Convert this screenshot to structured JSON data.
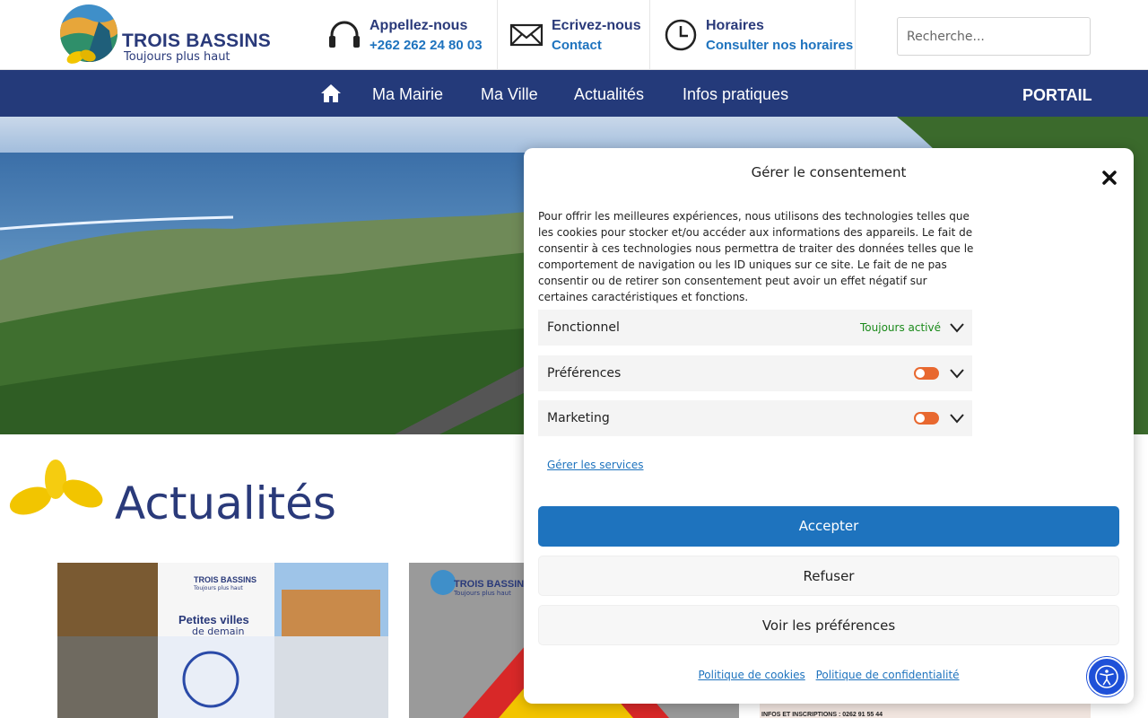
{
  "header": {
    "logo": {
      "name": "TROIS BASSINS",
      "tagline": "Toujours plus haut"
    },
    "contacts": [
      {
        "title": "Appellez-nous",
        "value": "+262 262 24 80 03",
        "icon": "headset-icon"
      },
      {
        "title": "Ecrivez-nous",
        "value": "Contact",
        "icon": "envelope-icon"
      },
      {
        "title": "Horaires",
        "value": "Consulter nos horaires",
        "icon": "clock-icon"
      }
    ],
    "search_placeholder": "Recherche..."
  },
  "nav": {
    "home_icon": "home-icon",
    "items": [
      "Ma Mairie",
      "Ma Ville",
      "Actualités",
      "Infos pratiques"
    ],
    "portail": "PORTAIL"
  },
  "section": {
    "title": "Actualités",
    "card1_overlay": {
      "brand": "TROIS BASSINS",
      "tagline": "Toujours plus haut",
      "line1": "Petites villes",
      "line2": "de demain"
    },
    "card2_overlay": {
      "brand": "TROIS BASSINS",
      "tagline": "Toujours plus haut"
    },
    "card3_overlay": {
      "text": "INFOS ET INSCRIPTIONS : 0262 91 55 44"
    }
  },
  "consent": {
    "title": "Gérer le consentement",
    "text": "Pour offrir les meilleures expériences, nous utilisons des technologies telles que les cookies pour stocker et/ou accéder aux informations des appareils. Le fait de consentir à ces technologies nous permettra de traiter des données telles que le comportement de navigation ou les ID uniques sur ce site. Le fait de ne pas consentir ou de retirer son consentement peut avoir un effet négatif sur certaines caractéristiques et fonctions.",
    "categories": [
      {
        "label": "Fonctionnel",
        "status": "Toujours activé"
      },
      {
        "label": "Préférences",
        "enabled": false
      },
      {
        "label": "Marketing",
        "enabled": false
      }
    ],
    "manage_services": "Gérer les services",
    "accept": "Accepter",
    "refuse": "Refuser",
    "view_prefs": "Voir les préférences",
    "cookie_policy": "Politique de cookies",
    "privacy_policy": "Politique de confidentialité"
  },
  "colors": {
    "brand_blue": "#243a7a",
    "link_blue": "#1e73be",
    "toggle_off": "#e8682f",
    "active_green": "#1a8a1a",
    "leaf_yellow": "#f2c500"
  },
  "accessibility": {
    "icon": "accessibility-icon"
  }
}
